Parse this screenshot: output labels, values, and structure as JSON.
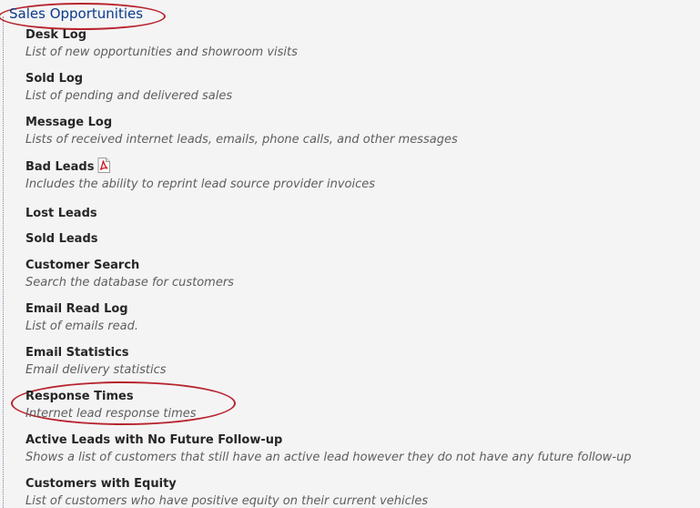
{
  "section": {
    "title": "Sales Opportunities"
  },
  "items": [
    {
      "title": "Desk Log",
      "desc": "List of new opportunities and showroom visits"
    },
    {
      "title": "Sold Log",
      "desc": "List of pending and delivered sales"
    },
    {
      "title": "Message Log",
      "desc": "Lists of received internet leads, emails, phone calls, and other messages"
    },
    {
      "title": "Bad Leads",
      "desc": "Includes the ability to reprint lead source provider invoices",
      "icon": "pdf-icon"
    },
    {
      "title": "Lost Leads"
    },
    {
      "title": "Sold Leads"
    },
    {
      "title": "Customer Search",
      "desc": "Search the database for customers"
    },
    {
      "title": "Email Read Log",
      "desc": "List of emails read."
    },
    {
      "title": "Email Statistics",
      "desc": "Email delivery statistics"
    },
    {
      "title": "Response Times",
      "desc": "Internet lead response times"
    },
    {
      "title": "Active Leads with No Future Follow-up",
      "desc": "Shows a list of customers that still have an active lead however they do not have any future follow-up"
    },
    {
      "title": "Customers with Equity",
      "desc": "List of customers who have positive equity on their current vehicles"
    }
  ],
  "colors": {
    "background": "#f4f4f4",
    "section_title": "#0a3a8c",
    "highlight_ring": "#b8242e",
    "item_title": "#262626",
    "item_desc": "#5e5e5e"
  }
}
